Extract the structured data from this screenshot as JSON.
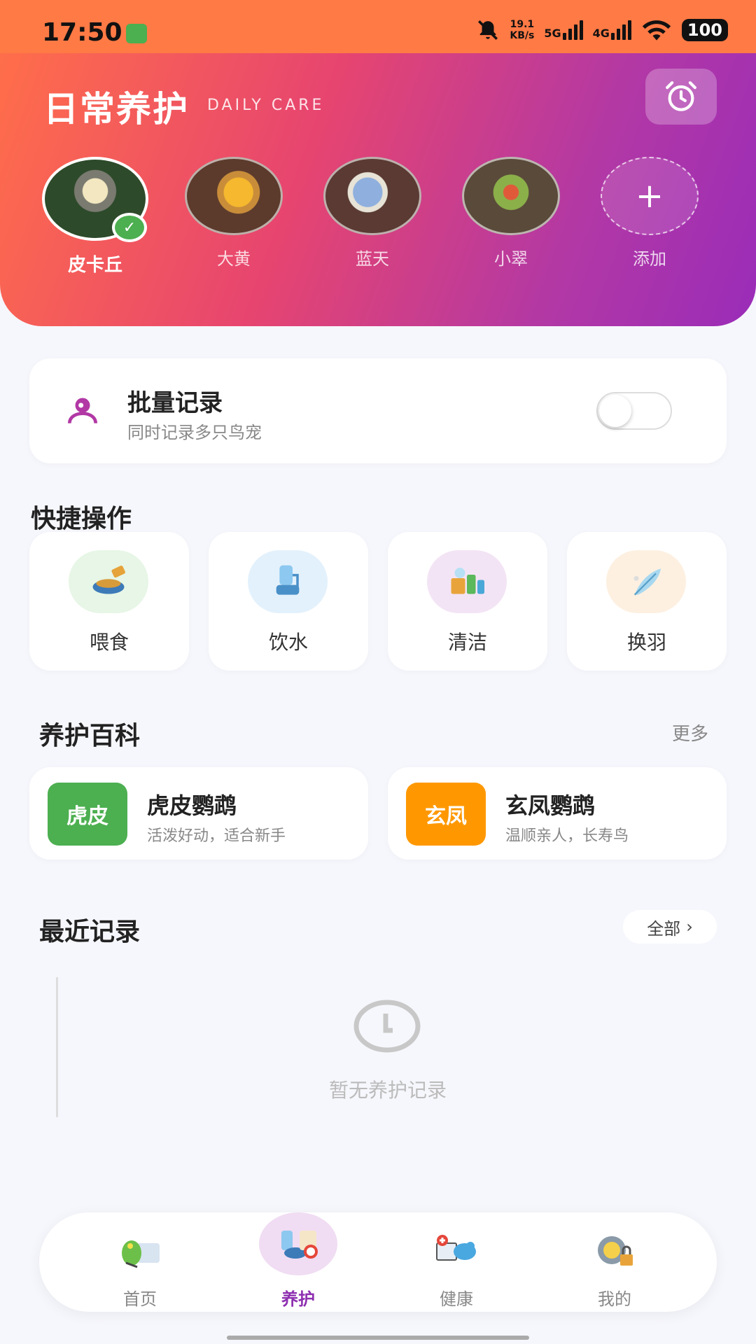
{
  "status_bar": {
    "time": "17:50",
    "speed_value": "19.1",
    "speed_unit": "KB/s",
    "net1": "5G",
    "net2": "4G",
    "battery": "100"
  },
  "header": {
    "title": "日常养护",
    "subtitle": "DAILY CARE",
    "alarm_icon": "alarm-clock-icon"
  },
  "pets": [
    {
      "name": "皮卡丘",
      "selected": true
    },
    {
      "name": "大黄",
      "selected": false
    },
    {
      "name": "蓝天",
      "selected": false
    },
    {
      "name": "小翠",
      "selected": false
    },
    {
      "name": "添加",
      "add": "+"
    }
  ],
  "batch": {
    "title": "批量记录",
    "subtitle": "同时记录多只鸟宠",
    "enabled": false
  },
  "quick_actions": {
    "title": "快捷操作",
    "items": [
      {
        "label": "喂食",
        "icon": "food-bowl-icon"
      },
      {
        "label": "饮水",
        "icon": "water-dispenser-icon"
      },
      {
        "label": "清洁",
        "icon": "cleaning-icon"
      },
      {
        "label": "换羽",
        "icon": "feather-icon"
      }
    ]
  },
  "encyclopedia": {
    "title": "养护百科",
    "more": "更多",
    "items": [
      {
        "badge": "虎皮",
        "title": "虎皮鹦鹉",
        "subtitle": "活泼好动，适合新手",
        "color": "#4caf50"
      },
      {
        "badge": "玄凤",
        "title": "玄凤鹦鹉",
        "subtitle": "温顺亲人，长寿鸟",
        "color": "#ff9800"
      }
    ]
  },
  "recent": {
    "title": "最近记录",
    "all": "全部",
    "all_chevron": "›",
    "empty": "暂无养护记录"
  },
  "tabbar": [
    {
      "label": "首页"
    },
    {
      "label": "养护",
      "active": true
    },
    {
      "label": "健康"
    },
    {
      "label": "我的"
    }
  ],
  "colors": {
    "accent": "#8e2fb0",
    "header_start": "#ff6e4a",
    "header_end": "#9a2cb8"
  }
}
